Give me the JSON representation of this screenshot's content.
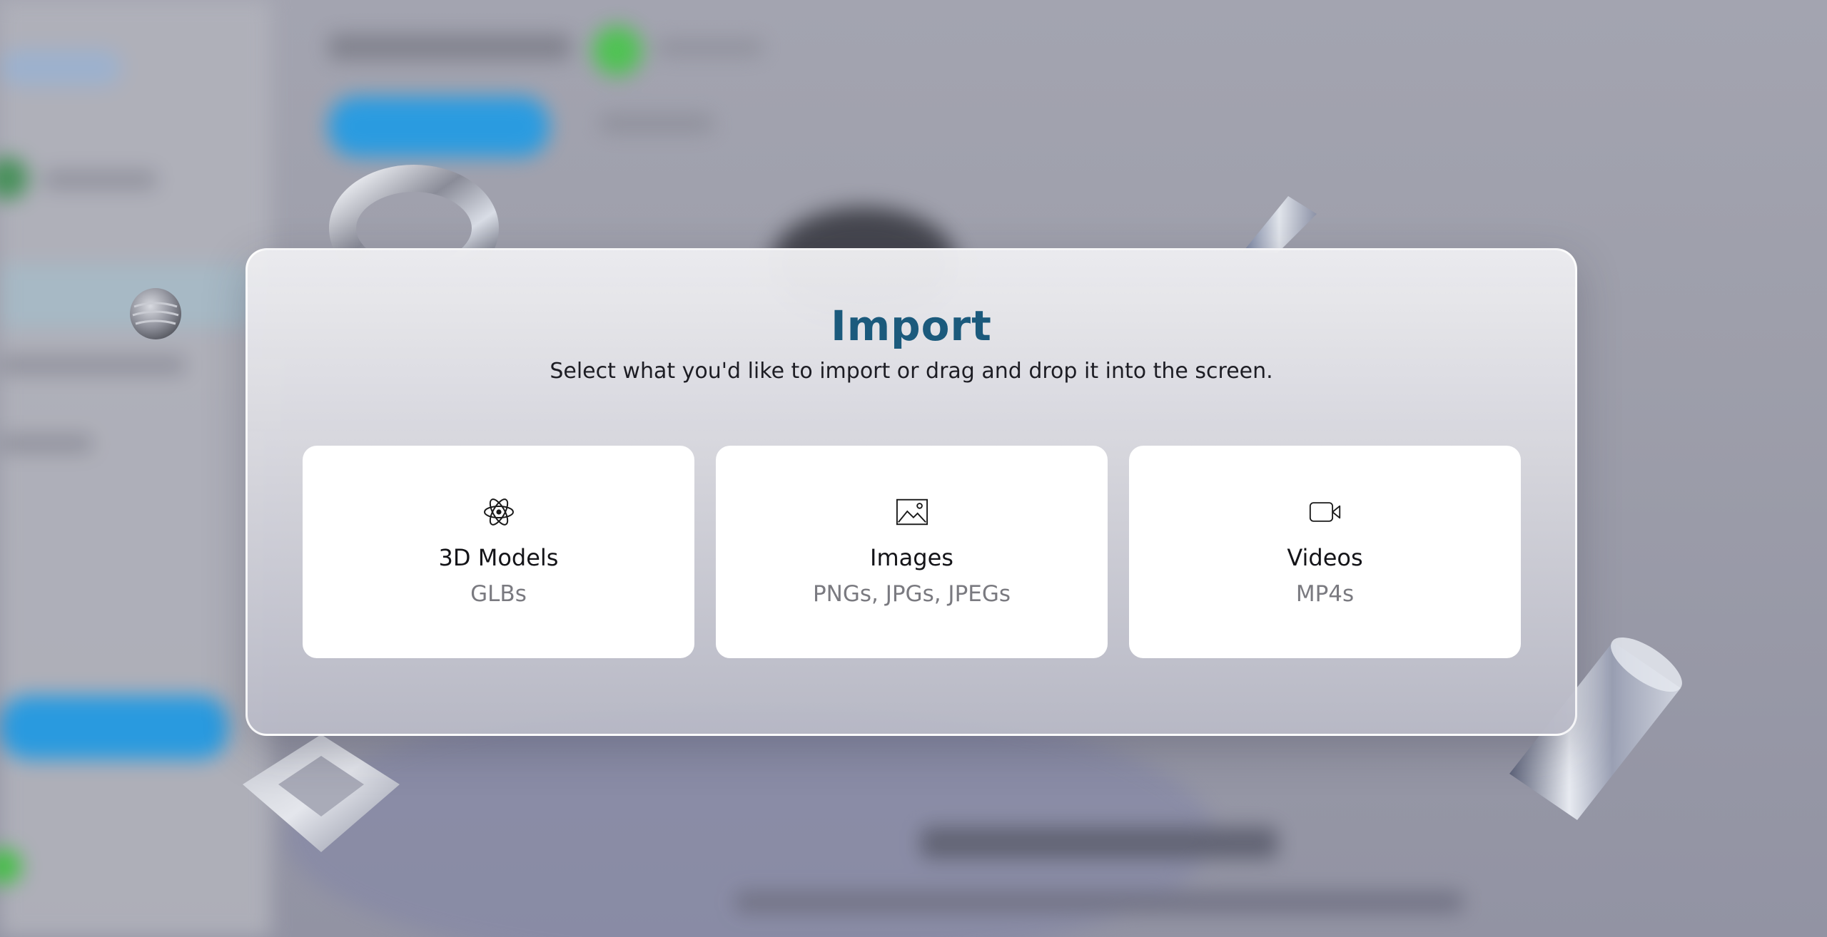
{
  "modal": {
    "title": "Import",
    "subtitle": "Select what you'd like to import or drag and drop it into the screen.",
    "options": [
      {
        "icon": "atom-icon",
        "label": "3D Models",
        "formats": "GLBs"
      },
      {
        "icon": "image-icon",
        "label": "Images",
        "formats": "PNGs, JPGs, JPEGs"
      },
      {
        "icon": "video-camera-icon",
        "label": "Videos",
        "formats": "MP4s"
      }
    ]
  },
  "colors": {
    "title": "#1b5a7c",
    "card_background": "#ffffff",
    "formats_text": "#7a7a80",
    "background_accent_blue": "#1e9be6",
    "background_accent_green": "#3cc43c"
  }
}
